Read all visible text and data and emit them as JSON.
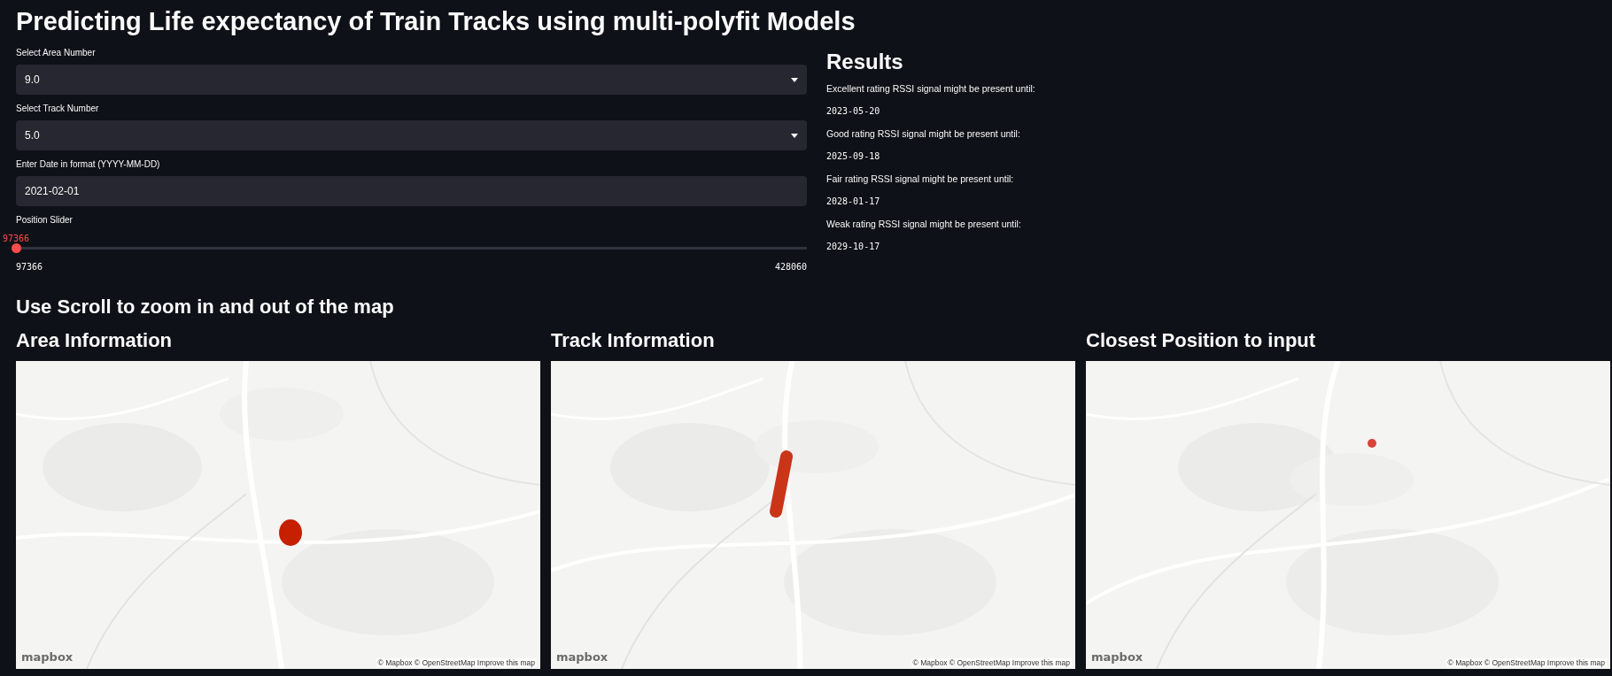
{
  "title": "Predicting Life expectancy of Train Tracks using multi-polyfit Models",
  "inputs": [
    {
      "kind": "select",
      "label": "Select Area Number",
      "value": "9.0"
    },
    {
      "kind": "select",
      "label": "Select Track Number",
      "value": "5.0"
    },
    {
      "kind": "text",
      "label": "Enter Date in format (YYYY-MM-DD)",
      "value": "2021-02-01"
    }
  ],
  "slider": {
    "label": "Position Slider",
    "value": "97366",
    "min": "97366",
    "max": "428060",
    "level": 0
  },
  "results": {
    "heading": "Results",
    "items": [
      {
        "text": "Excellent rating RSSI signal might be present until:",
        "date": "2023-05-20"
      },
      {
        "text": "Good rating RSSI signal might be present until:",
        "date": "2025-09-18"
      },
      {
        "text": "Fair rating RSSI signal might be present until:",
        "date": "2028-01-17"
      },
      {
        "text": "Weak rating RSSI signal might be present until:",
        "date": "2029-10-17"
      }
    ]
  },
  "map_hint": "Use Scroll to zoom in and out of the map",
  "maps": [
    {
      "heading": "Area Information",
      "kind": "blob",
      "logo": "mapbox",
      "attribution": "© Mapbox © OpenStreetMap Improve this map"
    },
    {
      "heading": "Track Information",
      "kind": "track",
      "logo": "mapbox",
      "attribution": "© Mapbox © OpenStreetMap Improve this map"
    },
    {
      "heading": "Closest Position to input",
      "kind": "dot",
      "logo": "mapbox",
      "attribution": "© Mapbox © OpenStreetMap Improve this map"
    }
  ]
}
